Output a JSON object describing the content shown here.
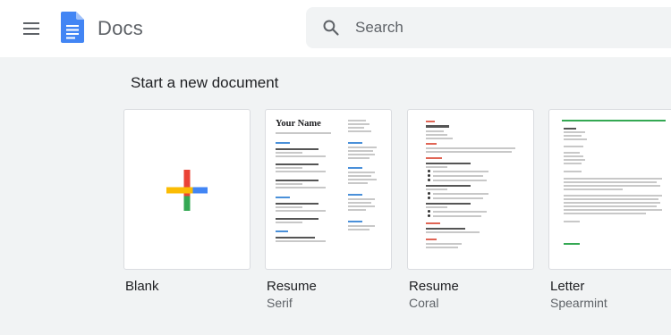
{
  "header": {
    "app_title": "Docs",
    "menu_icon": "hamburger-menu-icon",
    "logo_icon": "docs-logo-icon",
    "brand_color": "#4285f4"
  },
  "search": {
    "placeholder": "Search",
    "icon": "search-icon"
  },
  "gallery": {
    "title": "Start a new document",
    "templates": [
      {
        "name": "Blank",
        "subtitle": ""
      },
      {
        "name": "Resume",
        "subtitle": "Serif"
      },
      {
        "name": "Resume",
        "subtitle": "Coral"
      },
      {
        "name": "Letter",
        "subtitle": "Spearmint"
      }
    ]
  },
  "thumbnails": {
    "serif_resume_name": "Your Name"
  },
  "colors": {
    "background": "#f1f3f4",
    "plus_blue": "#4285f4",
    "plus_red": "#ea4335",
    "plus_yellow": "#fbbc04",
    "plus_green": "#34a853",
    "coral": "#e06555",
    "spearmint": "#34a853"
  }
}
